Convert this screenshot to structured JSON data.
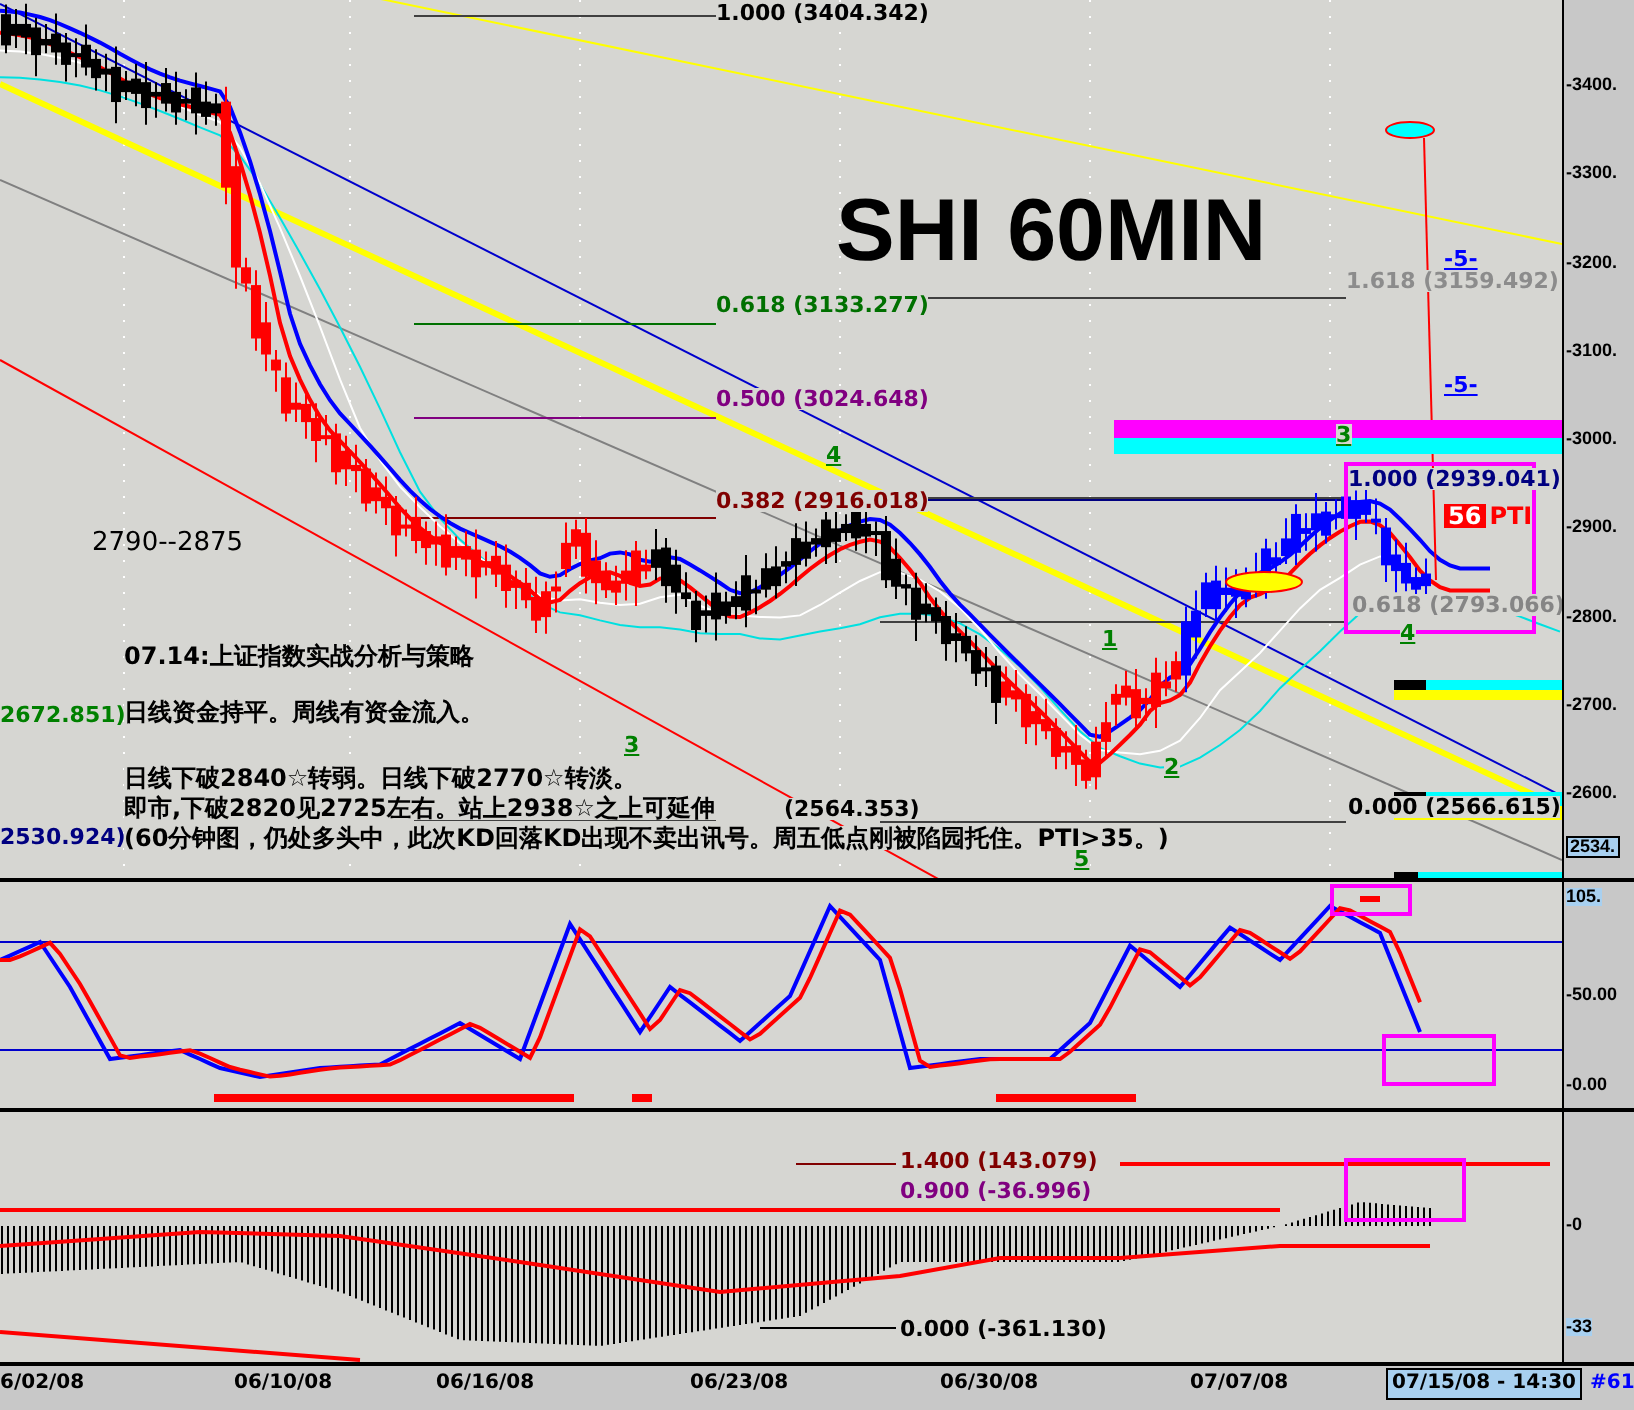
{
  "chart_title": "SHI 60MIN",
  "price_panel": {
    "fib_levels": [
      {
        "text": "1.000 (3404.342)",
        "color": "#000000"
      },
      {
        "text": "1.618 (3159.492)",
        "color": "#8c8c8c"
      },
      {
        "text": "0.618 (3133.277)",
        "color": "#007000"
      },
      {
        "text": "0.500 (3024.648)",
        "color": "#800080"
      },
      {
        "text": "1.000 (2939.041)",
        "color": "#000080"
      },
      {
        "text": "0.382 (2916.018)",
        "color": "#800000"
      },
      {
        "text": "0.618 (2793.066)",
        "color": "#858585"
      },
      {
        "text": "(2564.353)",
        "color": "#000000"
      },
      {
        "text": "0.000 (2566.615)",
        "color": "#000000"
      }
    ],
    "range_note": "2790--2875",
    "left_labels": [
      {
        "text": "2672.851)",
        "color": "#008000"
      },
      {
        "text": "2530.924)",
        "color": "#000080"
      }
    ],
    "notes": [
      "07.14:上证指数实战分析与策略",
      "日线资金持平。周线有资金流入。",
      "日线下破2840☆转弱。日线下破2770☆转淡。",
      "即市,下破2820见2725左右。站上2938☆之上可延伸",
      "(60分钟图，仍处多头中，此次KD回落KD出现不卖出讯号。周五低点刚被陷园托住。PTI>35。)"
    ],
    "wave_labels": [
      {
        "text": "4",
        "color": "#008000"
      },
      {
        "text": "3",
        "color": "#008000"
      },
      {
        "text": "1",
        "color": "#008000"
      },
      {
        "text": "2",
        "color": "#008000"
      },
      {
        "text": "5",
        "color": "#008000"
      },
      {
        "text": "3",
        "color": "#008000"
      },
      {
        "text": "4",
        "color": "#008000"
      },
      {
        "text": "-5-",
        "color": "#0000ff"
      },
      {
        "text": "-5-",
        "color": "#0000ff"
      }
    ],
    "pti_badge": {
      "value": "56",
      "label": "PTI"
    },
    "price_axis": [
      "-3400.",
      "-3300.",
      "-3200.",
      "-3100.",
      "-3000.",
      "-2900.",
      "-2800.",
      "-2700.",
      "-2600."
    ],
    "current_price": "2534."
  },
  "kd_panel": {
    "axis": [
      "105.",
      "-50.00",
      "-0.00"
    ]
  },
  "macd_panel": {
    "levels": [
      {
        "text": "1.400 (143.079)",
        "color": "#800000"
      },
      {
        "text": "0.900 (-36.996)",
        "color": "#800080"
      },
      {
        "text": "0.000 (-361.130)",
        "color": "#000000"
      }
    ],
    "axis": [
      "-0",
      "-33"
    ]
  },
  "date_axis": {
    "dates": [
      "6/02/08",
      "06/10/08",
      "06/16/08",
      "06/23/08",
      "06/30/08",
      "07/07/08"
    ],
    "current": "07/15/08 - 14:30",
    "bar_count": "#61"
  }
}
